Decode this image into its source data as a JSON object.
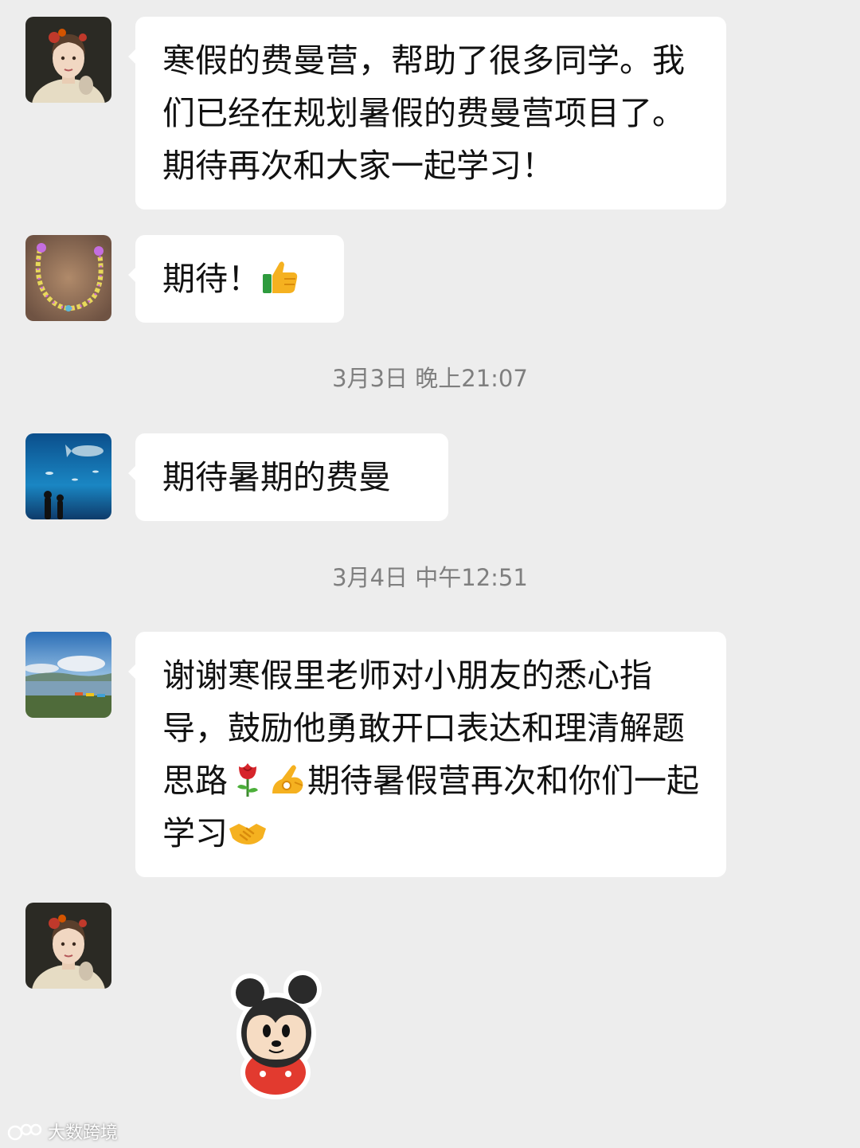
{
  "messages": [
    {
      "avatar": "girl-portrait-avatar",
      "text": "寒假的费曼营，帮助了很多同学。我们已经在规划暑假的费曼营项目了。期待再次和大家一起学习！"
    },
    {
      "avatar": "bead-necklace-avatar",
      "text": "期待！",
      "emoji": "thumbs-up-icon"
    },
    {
      "avatar": "aquarium-avatar",
      "text": "期待暑期的费曼"
    },
    {
      "avatar": "lake-landscape-avatar",
      "text_part1": "谢谢寒假里老师对小朋友的悉心指导，鼓励他勇敢开口表达和理清解题思路",
      "text_part2": "期待暑假营再次和你们一起学习",
      "emojis": [
        "rose-icon",
        "ok-hand-icon",
        "handshake-icon"
      ]
    },
    {
      "avatar": "girl-portrait-avatar",
      "sticker": "mickey-mouse-sticker"
    }
  ],
  "timestamps": [
    "3月3日 晚上21:07",
    "3月4日 中午12:51"
  ],
  "watermark": "大数跨境",
  "colors": {
    "background": "#ededed",
    "bubble": "#ffffff",
    "timestamp": "#7f7f7f"
  }
}
